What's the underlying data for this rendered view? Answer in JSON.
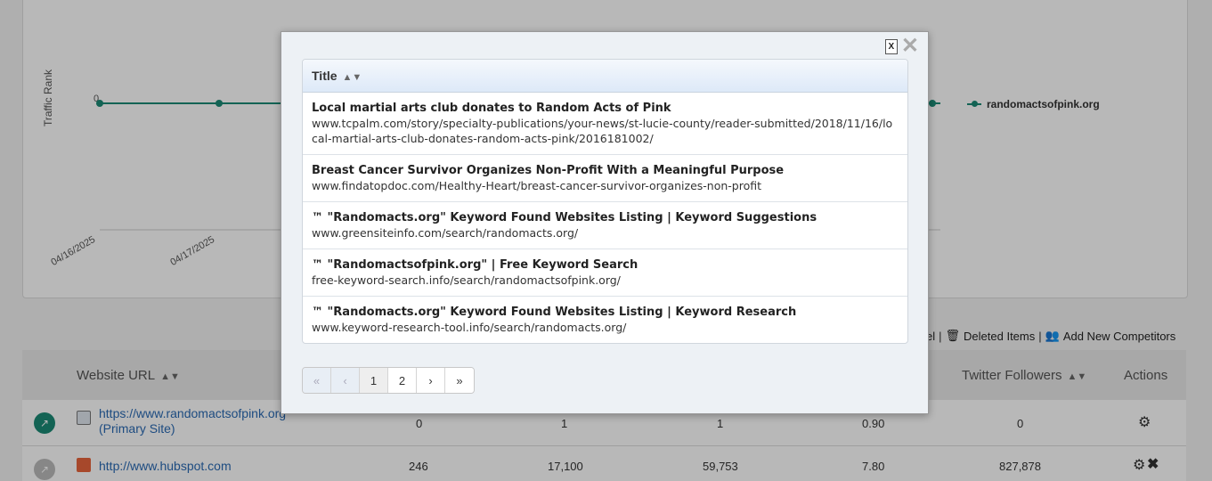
{
  "chart": {
    "y_axis_title": "Traffic Rank",
    "y_tick": "0",
    "x_ticks": [
      "04/16/2025",
      "04/17/2025"
    ],
    "legend_label": "randomactsofpink.org",
    "series_color": "#1b8a75"
  },
  "toolbar": {
    "partial_label": "el",
    "deleted_items": "Deleted Items",
    "add_competitors": "Add New Competitors"
  },
  "table": {
    "headers": {
      "website_url": "Website URL",
      "twitter_followers": "Twitter Followers",
      "actions": "Actions"
    },
    "rows": [
      {
        "url": "https://www.randomactsofpink.org",
        "note": "(Primary Site)",
        "c1": "0",
        "c2": "1",
        "c3": "1",
        "c4": "0.90",
        "twitter": "0"
      },
      {
        "url": "http://www.hubspot.com",
        "note": "",
        "c1": "246",
        "c2": "17,100",
        "c3": "59,753",
        "c4": "7.80",
        "twitter": "827,878"
      }
    ]
  },
  "modal": {
    "column_title": "Title",
    "results": [
      {
        "title": "Local martial arts club donates to Random Acts of Pink",
        "url": "www.tcpalm.com/story/specialty-publications/your-news/st-lucie-county/reader-submitted/2018/11/16/local-martial-arts-club-donates-random-acts-pink/2016181002/"
      },
      {
        "title": "Breast Cancer Survivor Organizes Non-Profit With a Meaningful Purpose",
        "url": "www.findatopdoc.com/Healthy-Heart/breast-cancer-survivor-organizes-non-profit"
      },
      {
        "title": "™ \"Randomacts.org\" Keyword Found Websites Listing | Keyword Suggestions",
        "url": "www.greensiteinfo.com/search/randomacts.org/"
      },
      {
        "title": "™ \"Randomactsofpink.org\" | Free Keyword Search",
        "url": "free-keyword-search.info/search/randomactsofpink.org/"
      },
      {
        "title": "™ \"Randomacts.org\" Keyword Found Websites Listing | Keyword Research",
        "url": "www.keyword-research-tool.info/search/randomacts.org/"
      }
    ],
    "pager": {
      "first": "«",
      "prev": "‹",
      "page1": "1",
      "page2": "2",
      "next": "›",
      "last": "»"
    }
  }
}
